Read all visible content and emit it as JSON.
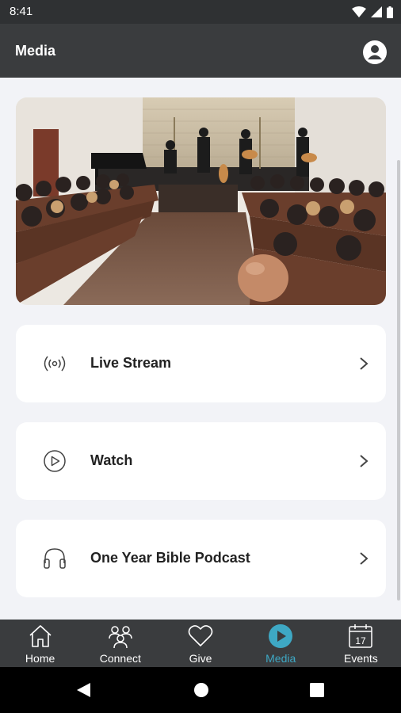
{
  "status_bar": {
    "time": "8:41"
  },
  "app_bar": {
    "title": "Media"
  },
  "menu": [
    {
      "label": "Live Stream",
      "icon": "broadcast-icon"
    },
    {
      "label": "Watch",
      "icon": "play-circle-icon"
    },
    {
      "label": "One Year Bible Podcast",
      "icon": "headphones-icon"
    }
  ],
  "bottom_nav": [
    {
      "label": "Home",
      "icon": "home-icon",
      "active": false
    },
    {
      "label": "Connect",
      "icon": "people-icon",
      "active": false
    },
    {
      "label": "Give",
      "icon": "heart-icon",
      "active": false
    },
    {
      "label": "Media",
      "icon": "play-circle-icon",
      "active": true
    },
    {
      "label": "Events",
      "icon": "calendar-icon",
      "active": false
    }
  ],
  "calendar_day": "17",
  "colors": {
    "accent": "#3ea8c4",
    "bar": "#3a3c3e",
    "background": "#f2f3f7"
  }
}
